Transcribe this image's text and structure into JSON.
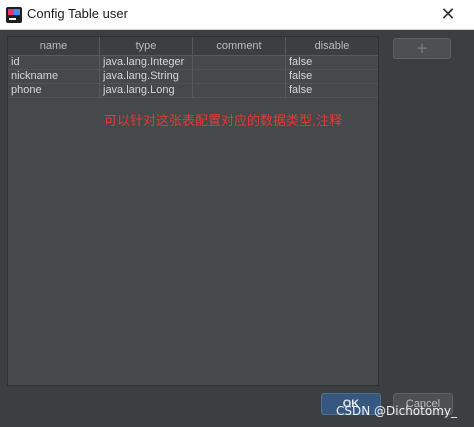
{
  "window": {
    "title": "Config Table user",
    "close_glyph": "✕"
  },
  "table": {
    "columns": [
      "name",
      "type",
      "comment",
      "disable"
    ],
    "rows": [
      [
        "id",
        "java.lang.Integer",
        "",
        "false"
      ],
      [
        "nickname",
        "java.lang.String",
        "",
        "false"
      ],
      [
        "phone",
        "java.lang.Long",
        "",
        "false"
      ]
    ]
  },
  "annotation": "可以针对这张表配置对应的数据类型,注释",
  "toolbar": {
    "add_label": "+"
  },
  "footer": {
    "ok_label": "OK",
    "cancel_label": "Cancel"
  },
  "watermark": "CSDN @Dichotomy_",
  "colors": {
    "annotation": "#e53935",
    "ok_button": "#365880",
    "panel": "#3c3f41"
  }
}
